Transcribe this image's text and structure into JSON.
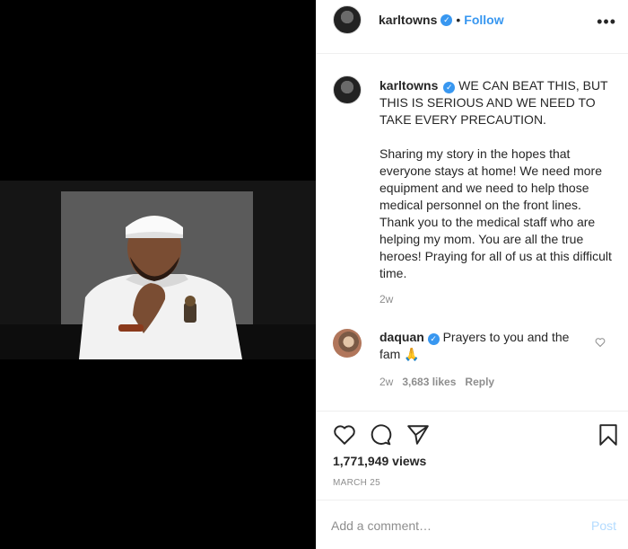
{
  "post": {
    "header": {
      "username": "karltowns",
      "verified_icon": "verified-badge-icon",
      "separator": "•",
      "follow_label": "Follow",
      "more_label": "•••"
    },
    "caption": {
      "username": "karltowns",
      "text": "WE CAN BEAT THIS, BUT THIS IS SERIOUS AND WE NEED TO TAKE EVERY PRECAUTION.\n\nSharing my story in the hopes that everyone stays at home! We need more equipment and we need to help those medical personnel on the front lines. Thank you to the medical staff who are helping my mom. You are all the true heroes! Praying for all of us at this difficult time.",
      "time": "2w"
    },
    "comments": [
      {
        "username": "daquan",
        "text": "Prayers to you and the fam 🙏",
        "time": "2w",
        "likes": "3,683 likes",
        "reply_label": "Reply"
      }
    ],
    "views": "1,771,949 views",
    "date": "MARCH 25",
    "add_comment": {
      "placeholder": "Add a comment…",
      "post_label": "Post"
    },
    "colors": {
      "accent": "#3897f0",
      "post_disabled": "#b3dbff",
      "muted": "#8e8e8e"
    }
  }
}
